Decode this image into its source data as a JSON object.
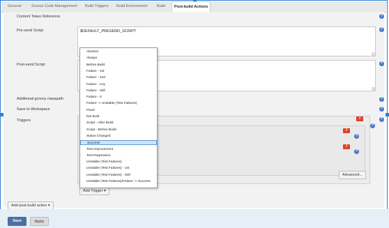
{
  "tabs": [
    "General",
    "Source Code Management",
    "Build Triggers",
    "Build Environment",
    "Build",
    "Post-build Actions"
  ],
  "active_tab": "Post-build Actions",
  "fields": {
    "content_token_reference": "Content Token Reference",
    "pre_send_script": "Pre-send Script",
    "pre_send_value": "$DEFAULT_PRESEND_SCRIPT",
    "post_send_script": "Post-send Script",
    "additional_groovy_classpath": "Additional groovy classpath",
    "save_to_workspace": "Save to Workspace",
    "triggers": "Triggers"
  },
  "help_label": "?",
  "delete_label": "X",
  "advanced_button": "Advanced...",
  "add_trigger_button": "Add Trigger",
  "add_post_build_button": "Add post-build action",
  "save_button": "Save",
  "apply_button": "Apply",
  "dropdown": {
    "selected": "Success",
    "items": [
      "Aborted",
      "Always",
      "Before Build",
      "Failure - 1st",
      "Failure - 2nd",
      "Failure - Any",
      "Failure - Still",
      "Failure - X",
      "Failure -> Unstable (Test Failures)",
      "Fixed",
      "Not Built",
      "Script - After Build",
      "Script - Before Build",
      "Status Changed",
      "Success",
      "Test Improvement",
      "Test Regression",
      "Unstable (Test Failures)",
      "Unstable (Test Failures) - 1st",
      "Unstable (Test Failures) - Still",
      "Unstable (Test Failures)/Failure -> Success"
    ]
  }
}
